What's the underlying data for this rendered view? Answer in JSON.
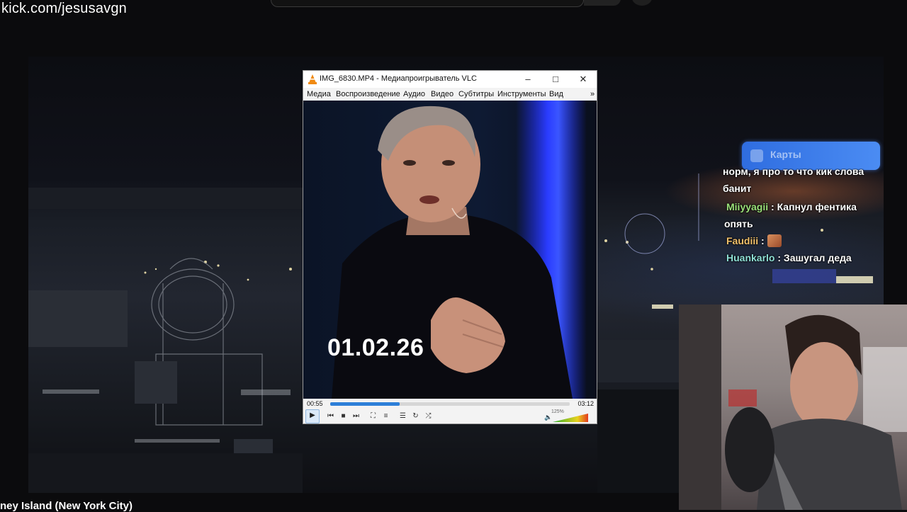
{
  "stream": {
    "url": "kick.com/jesusavgn",
    "bottom_title": "ney Island (New York City)"
  },
  "chat": {
    "maps_label": "Карты",
    "clipped_text": "норм, я про то что кик слова банит",
    "messages": [
      {
        "user": "Miiyyagii",
        "text": "Капнул фентика опять",
        "color": "#9be27a"
      },
      {
        "user": "Faudiii",
        "text": "",
        "color": "#f2c16b",
        "emote": "emote"
      },
      {
        "user": "Huankarlo",
        "text": "Зашугал деда",
        "color": "#8fe0d6"
      }
    ]
  },
  "vlc": {
    "title": "IMG_6830.MP4 - Медиапроигрыватель VLC",
    "menu": [
      "Медиа",
      "Воспроизведение",
      "Аудио",
      "Видео",
      "Субтитры",
      "Инструменты",
      "Вид"
    ],
    "menu_overflow": "»",
    "video_overlay_text": "01.02.26",
    "time_current": "00:55",
    "time_total": "03:12",
    "progress": 0.29,
    "volume_label": "125%",
    "volume": 1.25,
    "icons": {
      "minimize": "minimize-icon",
      "maximize": "maximize-icon",
      "close": "close-icon",
      "play": "play-icon",
      "prev": "previous-icon",
      "stop": "stop-icon",
      "next": "next-icon",
      "fullscreen": "fullscreen-icon",
      "extended": "extended-settings-icon",
      "playlist": "playlist-icon",
      "loop": "loop-icon",
      "shuffle": "shuffle-icon",
      "volume": "volume-icon"
    },
    "accent_color": "#2d7fd8"
  }
}
